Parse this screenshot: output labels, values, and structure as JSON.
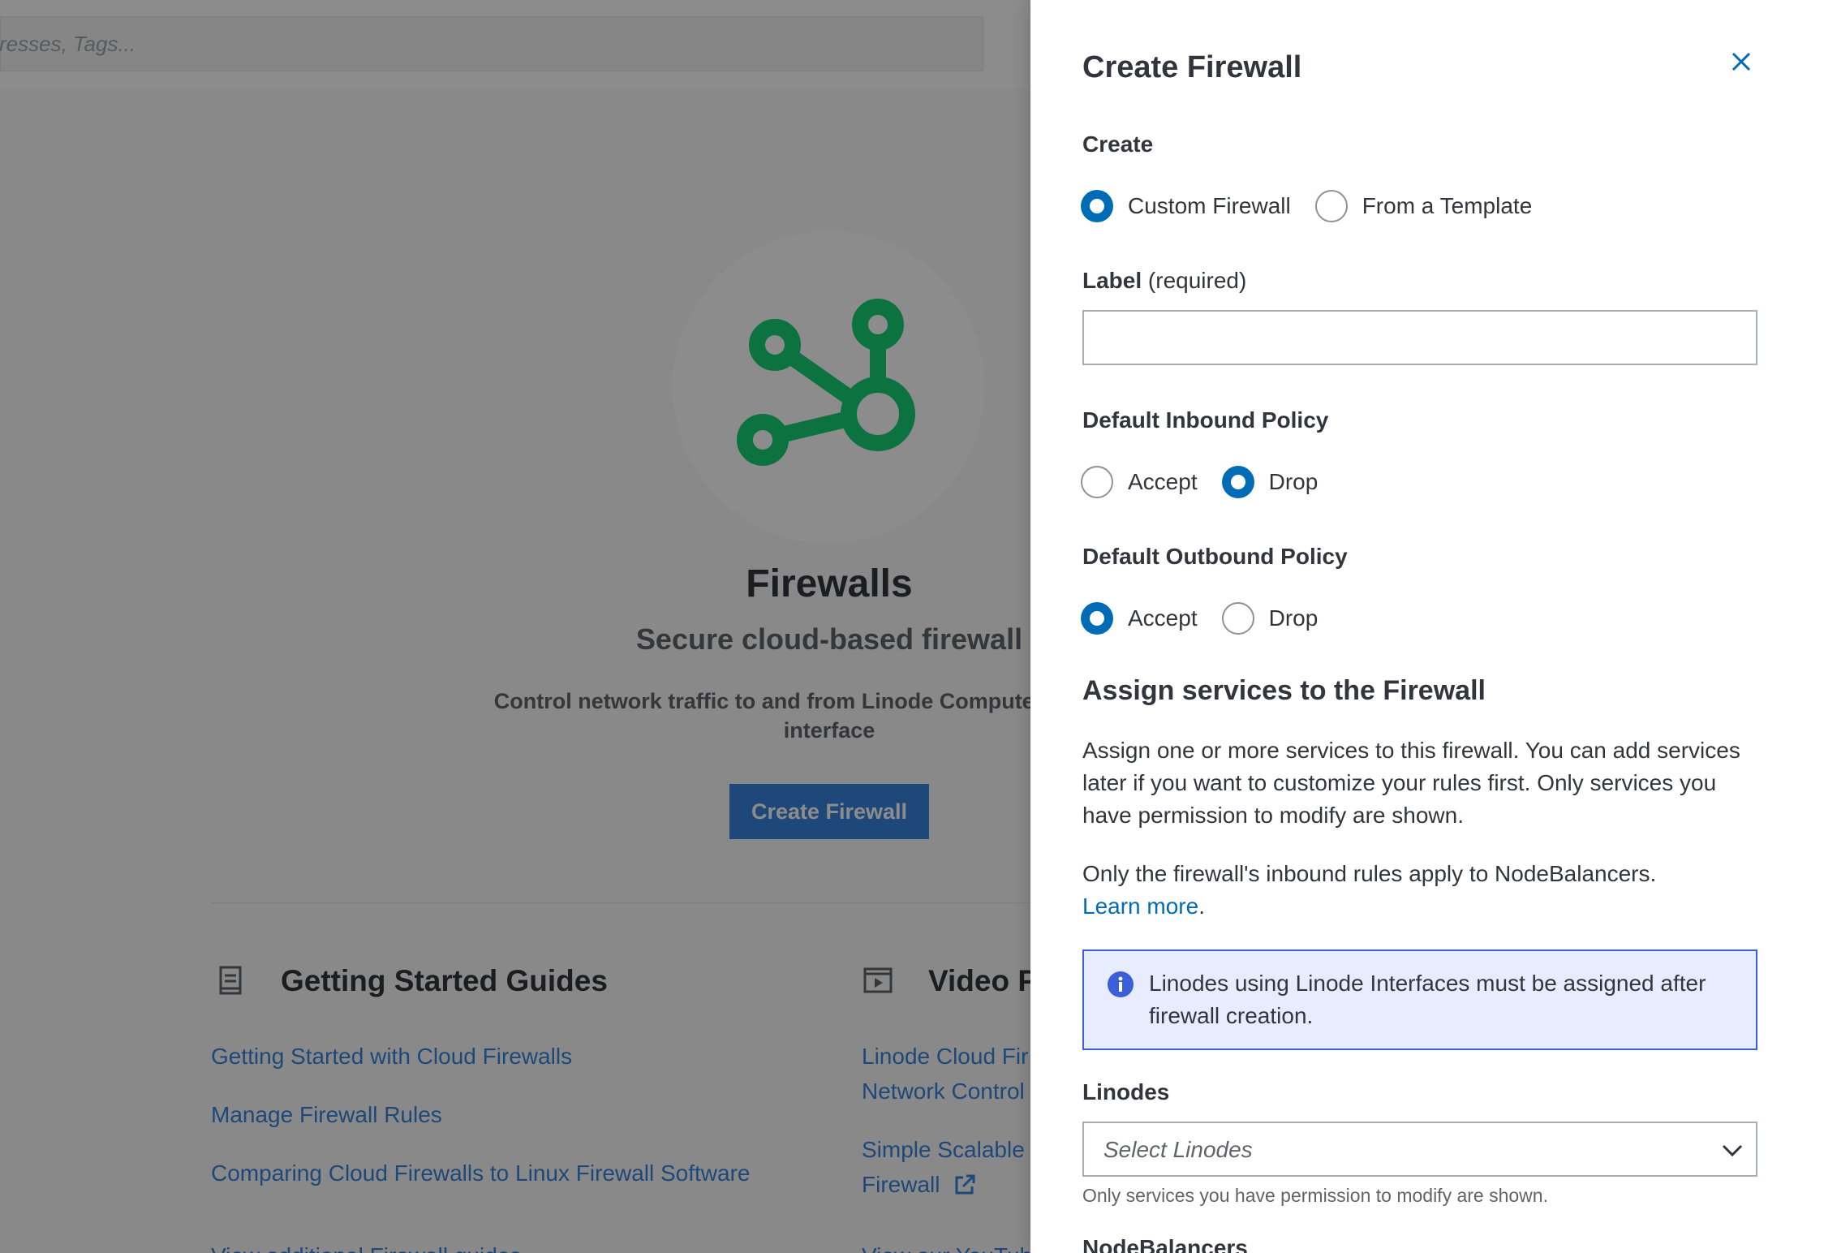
{
  "background": {
    "search": {
      "placeholder": "resses, Tags..."
    },
    "hero": {
      "icon": "firewall-network-icon",
      "title": "Firewalls",
      "subtitle": "Secure cloud-based firewall",
      "description_line1": "Control network traffic to and from Linode Compute Instances w",
      "description_line2": "interface",
      "button_label": "Create Firewall"
    },
    "guides": {
      "heading": "Getting Started Guides",
      "icon": "document-icon",
      "links": [
        "Getting Started with Cloud Firewalls",
        "Manage Firewall Rules",
        "Comparing Cloud Firewalls to Linux Firewall Software"
      ],
      "more_link": "View additional Firewall guides"
    },
    "videos": {
      "heading": "Video Pl",
      "icon": "video-playlist-icon",
      "links": [
        "Linode Cloud Fir",
        "Network Control",
        "Simple Scalable",
        "Firewall"
      ],
      "more_link": "View our YouTube"
    },
    "colors": {
      "accent": "#3683dc",
      "hero_icon": "#17cf73"
    }
  },
  "drawer": {
    "title": "Create Firewall",
    "close_icon": "close-icon",
    "create_section": {
      "label": "Create",
      "options": [
        "Custom Firewall",
        "From a Template"
      ],
      "selected": "Custom Firewall"
    },
    "label_field": {
      "label": "Label",
      "qualifier": "(required)",
      "value": ""
    },
    "inbound_policy": {
      "label": "Default Inbound Policy",
      "options": [
        "Accept",
        "Drop"
      ],
      "selected": "Drop"
    },
    "outbound_policy": {
      "label": "Default Outbound Policy",
      "options": [
        "Accept",
        "Drop"
      ],
      "selected": "Accept"
    },
    "assign": {
      "title": "Assign services to the Firewall",
      "paragraph1": "Assign one or more services to this firewall. You can add services later if you want to customize your rules first. Only services you have permission to modify are shown.",
      "paragraph2": "Only the firewall's inbound rules apply to NodeBalancers.",
      "learn_more": "Learn more",
      "learn_more_suffix": "."
    },
    "notice": {
      "icon": "info-icon",
      "text": "Linodes using Linode Interfaces must be assigned after firewall creation."
    },
    "linodes": {
      "label": "Linodes",
      "placeholder": "Select Linodes",
      "helper": "Only services you have permission to modify are shown."
    },
    "nodebalancers": {
      "label": "NodeBalancers"
    },
    "colors": {
      "radio_checked": "#006cb6",
      "notice_border": "#3b5fdb",
      "notice_bg": "#e7ecfe"
    }
  }
}
